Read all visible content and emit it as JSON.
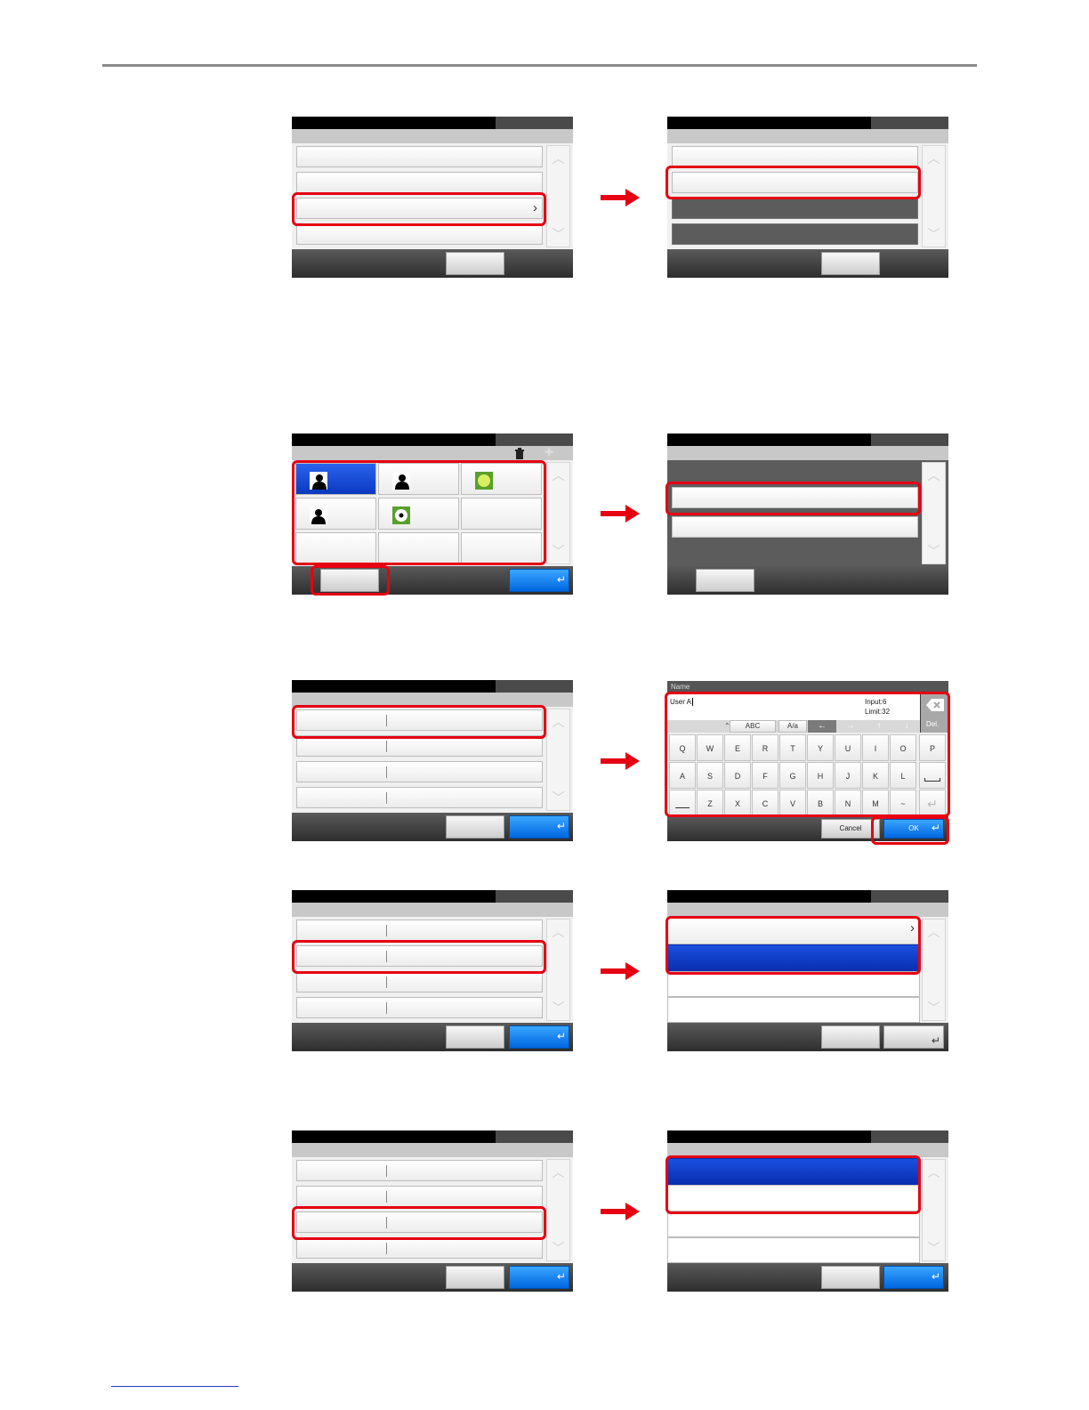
{
  "keyboard": {
    "header_label": "Name",
    "input_value": "User A",
    "input_count": "Input:6",
    "input_limit": "Limit:32",
    "delete_label": "Del.",
    "mode_abc": "ABC",
    "mode_case": "A/a",
    "row1": [
      "Q",
      "W",
      "E",
      "R",
      "T",
      "Y",
      "U",
      "I",
      "O",
      "P"
    ],
    "row2": [
      "A",
      "S",
      "D",
      "F",
      "G",
      "H",
      "J",
      "K",
      "L"
    ],
    "row3": [
      "Z",
      "X",
      "C",
      "V",
      "B",
      "N",
      "M",
      "~"
    ],
    "cancel_label": "Cancel",
    "ok_label": "OK"
  },
  "colors": {
    "highlight": "#e60012",
    "selection_blue": "#0b39c0",
    "ok_blue": "#0066e0"
  },
  "icons": [
    "trash-icon",
    "scroll-up-icon",
    "scroll-down-icon",
    "enter-icon",
    "backspace-icon",
    "arrow-right-icon"
  ]
}
